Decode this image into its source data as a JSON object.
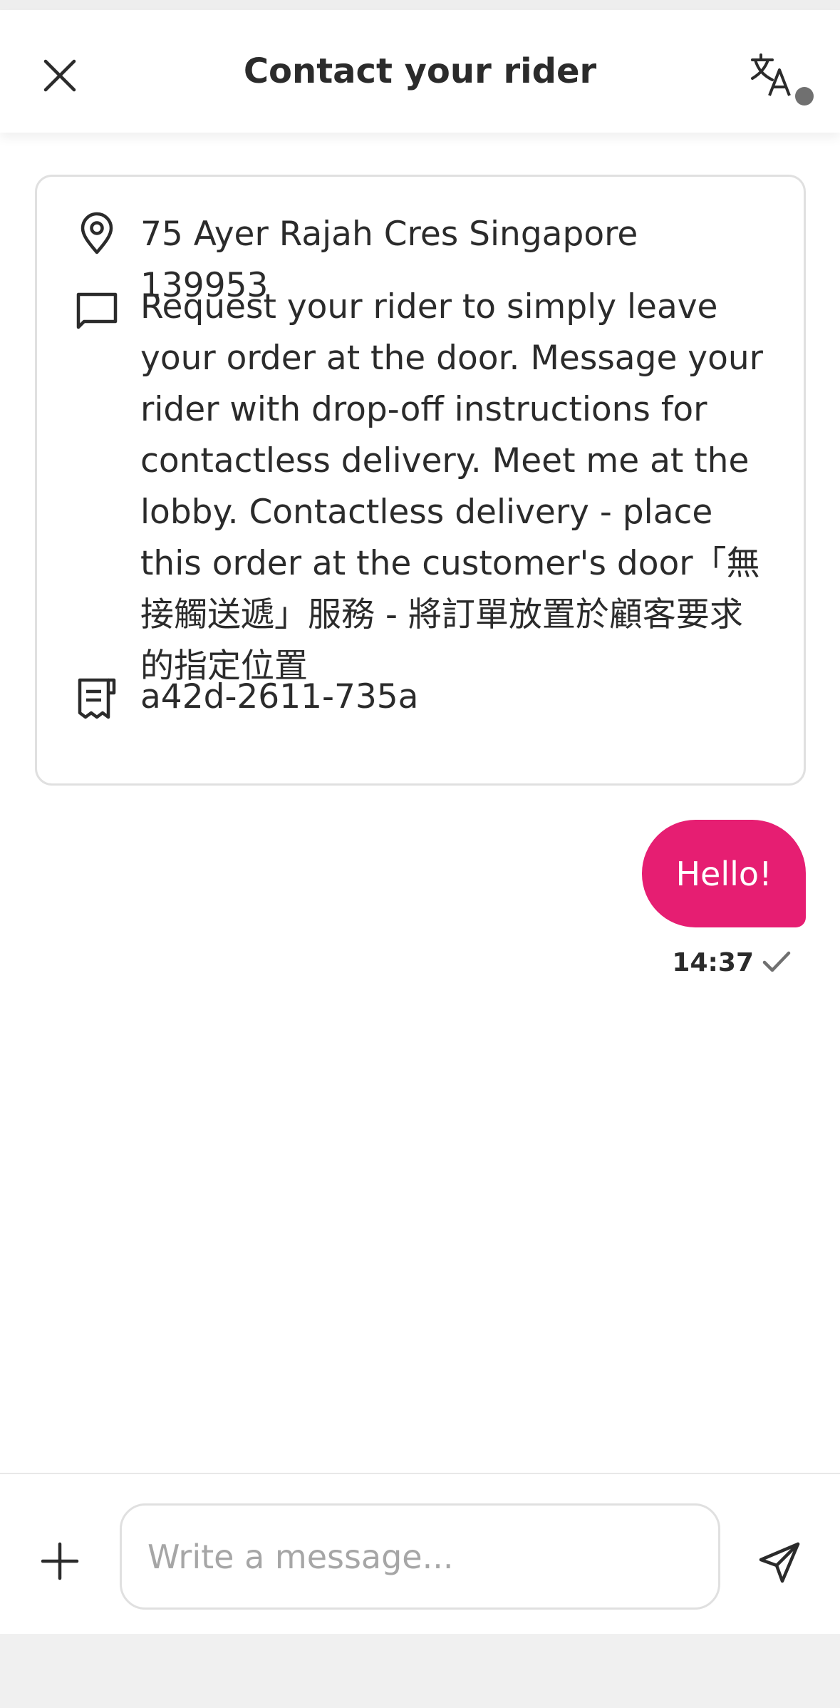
{
  "header": {
    "title": "Contact your rider",
    "close_icon": "close-icon",
    "translate_icon": "translate-icon"
  },
  "info_card": {
    "address": "75 Ayer Rajah Cres Singapore 139953",
    "instructions": "Request your rider to simply leave your order at the door. Message your rider with drop-off instructions for contactless delivery. Meet me at the lobby. Contactless delivery - place this order at the customer's door「無接觸送遞」服務 - 將訂單放置於顧客要求的指定位置",
    "order_code": "a42d-2611-735a",
    "icons": [
      "location-pin-icon",
      "message-icon",
      "receipt-icon"
    ]
  },
  "messages": [
    {
      "text": "Hello!",
      "time": "14:37",
      "status_icon": "check-icon"
    }
  ],
  "composer": {
    "placeholder": "Write a message...",
    "add_icon": "plus-icon",
    "send_icon": "send-icon"
  },
  "colors": {
    "accent": "#e61e72",
    "text": "#2b2b2b",
    "placeholder": "#a6a6a6",
    "border": "#e0e0e0"
  }
}
